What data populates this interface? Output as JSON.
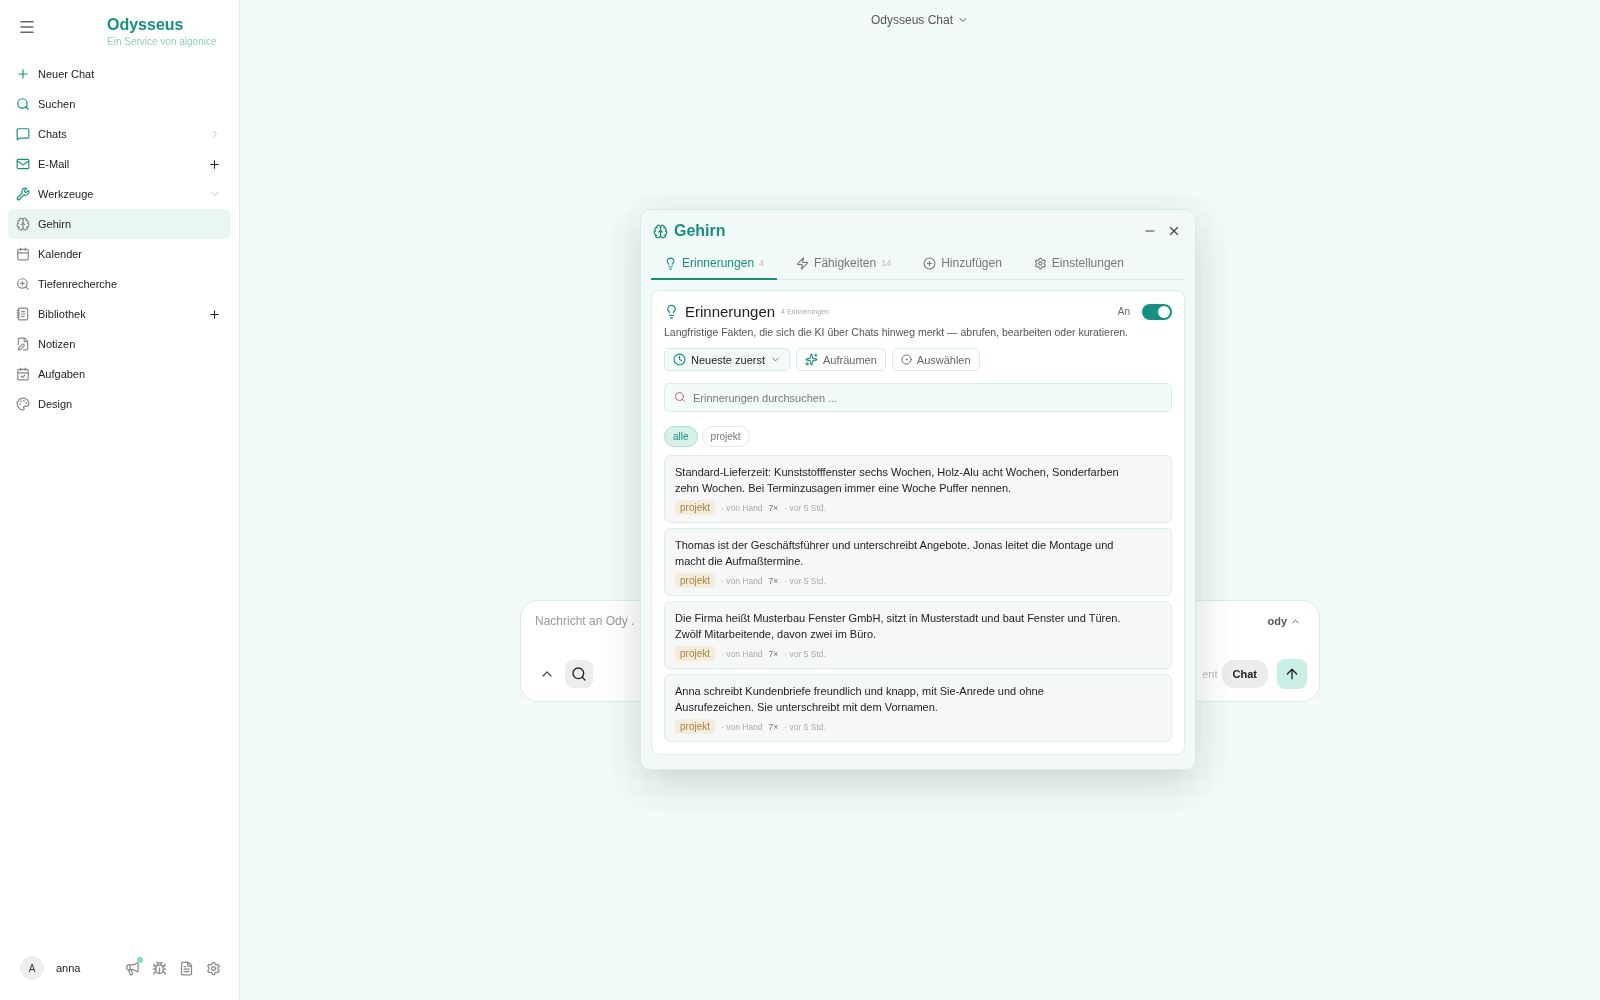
{
  "sidebar": {
    "brand": "Odysseus",
    "tagline": "Ein Service von algonice",
    "items": [
      {
        "label": "Neuer Chat",
        "selected": false
      },
      {
        "label": "Suchen",
        "selected": false
      },
      {
        "label": "Chats",
        "selected": false,
        "expanded": false
      },
      {
        "label": "E-Mail",
        "selected": false,
        "can_add": true
      },
      {
        "label": "Werkzeuge",
        "selected": false,
        "expanded": true,
        "children": [
          {
            "label": "Gehirn",
            "selected": true
          },
          {
            "label": "Kalender",
            "selected": false
          },
          {
            "label": "Tiefenrecherche",
            "selected": false
          },
          {
            "label": "Bibliothek",
            "selected": false,
            "can_add": true
          },
          {
            "label": "Notizen",
            "selected": false
          },
          {
            "label": "Aufgaben",
            "selected": false
          },
          {
            "label": "Design",
            "selected": false
          }
        ]
      }
    ],
    "user": {
      "initial": "A",
      "name": "anna",
      "news_unread": true
    }
  },
  "header": {
    "title": "Odysseus Chat"
  },
  "composer": {
    "placeholder": "Nachricht an Ody .",
    "model": "ody",
    "modes": [
      {
        "label": "ent",
        "selected": false
      },
      {
        "label": "Chat",
        "selected": true
      }
    ]
  },
  "dialog": {
    "title": "Gehirn",
    "tabs": [
      {
        "label": "Erinnerungen",
        "count": "4",
        "selected": true
      },
      {
        "label": "Fähigkeiten",
        "count": "14",
        "selected": false
      },
      {
        "label": "Hinzufügen",
        "selected": false
      },
      {
        "label": "Einstellungen",
        "selected": false
      }
    ],
    "section": {
      "title": "Erinnerungen",
      "count": "4 Erinnerungen",
      "toggle_label": "An",
      "on": true,
      "description": "Langfristige Fakten, die sich die KI über Chats hinweg merkt — abrufen, bearbeiten oder kuratieren.",
      "sort": "Neueste zuerst",
      "actions": [
        "Aufräumen",
        "Auswählen"
      ],
      "search": {
        "placeholder": "Erinnerungen durchsuchen ..."
      },
      "filters": [
        {
          "label": "alle",
          "selected": true
        },
        {
          "label": "projekt",
          "selected": false
        }
      ],
      "memories": [
        {
          "text": "Standard-Lieferzeit: Kunststofffenster sechs Wochen, Holz-Alu acht Wochen, Sonderfarben zehn Wochen. Bei Terminzusagen immer eine Woche Puffer nennen.",
          "tag": "projekt",
          "source": "· von Hand",
          "uses": "7×",
          "age": "· vor 5 Std."
        },
        {
          "text": "Thomas ist der Geschäftsführer und unterschreibt Angebote. Jonas leitet die Montage und macht die Aufmaßtermine.",
          "tag": "projekt",
          "source": "· von Hand",
          "uses": "7×",
          "age": "· vor 5 Std."
        },
        {
          "text": "Die Firma heißt Musterbau Fenster GmbH, sitzt in Musterstadt und baut Fenster und Türen. Zwölf Mitarbeitende, davon zwei im Büro.",
          "tag": "projekt",
          "source": "· von Hand",
          "uses": "7×",
          "age": "· vor 5 Std."
        },
        {
          "text": "Anna schreibt Kundenbriefe freundlich und knapp, mit Sie-Anrede und ohne Ausrufezeichen. Sie unterschreibt mit dem Vornamen.",
          "tag": "projekt",
          "source": "· von Hand",
          "uses": "7×",
          "age": "· vor 5 Std."
        }
      ]
    }
  }
}
